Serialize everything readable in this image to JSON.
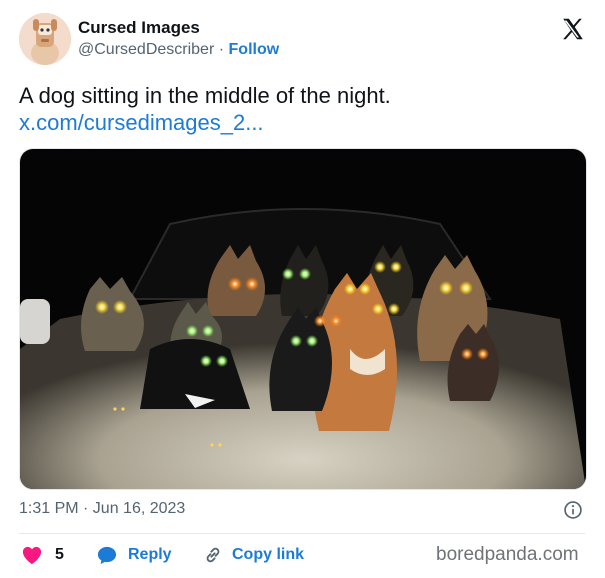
{
  "author": {
    "display_name": "Cursed Images",
    "handle": "@CursedDescriber",
    "separator": "·",
    "follow_label": "Follow"
  },
  "tweet": {
    "text": "A dog sitting in the middle of the night.",
    "link": "x.com/cursedimages_2..."
  },
  "meta": {
    "timestamp": "1:31 PM · Jun 16, 2023"
  },
  "actions": {
    "like_count": "5",
    "reply_label": "Reply",
    "copy_link_label": "Copy link"
  },
  "watermark": "boredpanda.com",
  "colors": {
    "link": "#1d7bd8",
    "like": "#f91880",
    "muted": "#536471"
  },
  "icons": [
    "x-logo-icon",
    "info-icon",
    "heart-icon",
    "reply-bubble-icon",
    "link-icon"
  ]
}
